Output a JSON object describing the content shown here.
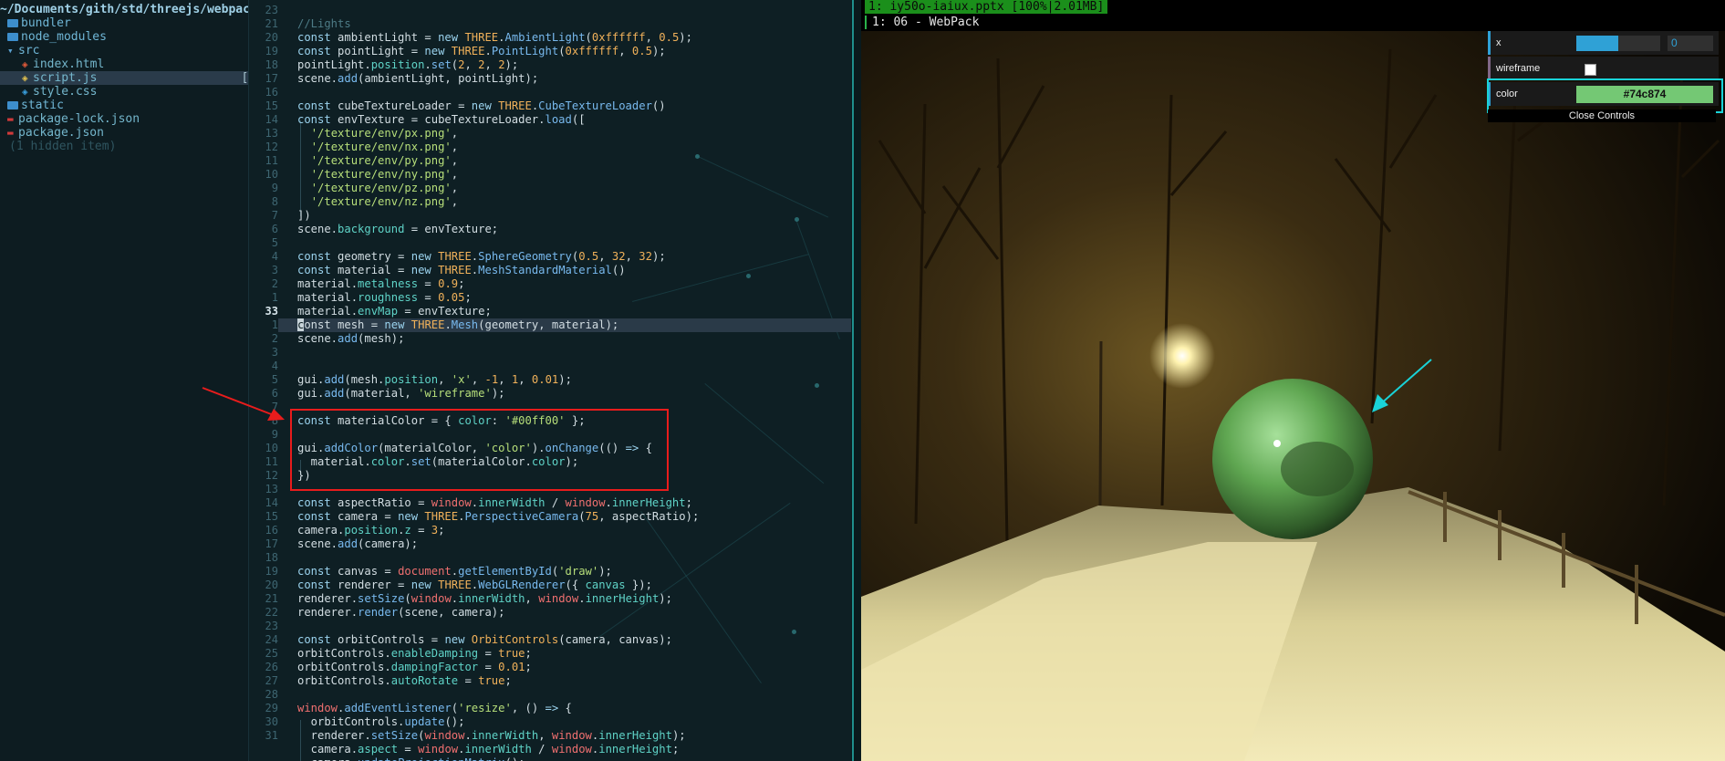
{
  "tree": {
    "root_path": "~/Documents/gith/std/threejs/webpack",
    "items": [
      {
        "name": "bundler",
        "kind": "folder"
      },
      {
        "name": "node_modules",
        "kind": "folder"
      },
      {
        "name": "src",
        "kind": "folder-open"
      },
      {
        "name": "index.html",
        "kind": "file"
      },
      {
        "name": "script.js",
        "kind": "file",
        "modified": "[+]"
      },
      {
        "name": "style.css",
        "kind": "file"
      },
      {
        "name": "static",
        "kind": "folder"
      },
      {
        "name": "package-lock.json",
        "kind": "file"
      },
      {
        "name": "package.json",
        "kind": "file"
      }
    ],
    "hidden_note": "(1 hidden item)"
  },
  "editor": {
    "current_line": "33",
    "line_numbers": [
      "23",
      "21",
      "20",
      "19",
      "18",
      "17",
      "16",
      "15",
      "14",
      "13",
      "12",
      "11",
      "10",
      "9",
      "8",
      "7",
      "6",
      "5",
      "4",
      "3",
      "2",
      "1",
      "33",
      "1",
      "2",
      "3",
      "4",
      "5",
      "6",
      "7",
      "8",
      "9",
      "10",
      "11",
      "12",
      "13",
      "14",
      "15",
      "16",
      "17",
      "18",
      "19",
      "20",
      "21",
      "22",
      "23",
      "24",
      "25",
      "26",
      "27",
      "28",
      "29",
      "30",
      "31"
    ]
  },
  "browser": {
    "tab1": "1: iy50o-iaiux.pptx [100%|2.01MB]",
    "tab2": "1: 06 - WebPack"
  },
  "gui": {
    "x_label": "x",
    "x_value": "0",
    "x_fraction": 0.5,
    "wireframe_label": "wireframe",
    "wireframe_checked": false,
    "color_label": "color",
    "color_value": "#74c874",
    "close_label": "Close Controls"
  },
  "colors": {
    "sphere": "#74c874",
    "annotation_red": "#e81c1c",
    "annotation_cyan": "#19d3d8"
  }
}
